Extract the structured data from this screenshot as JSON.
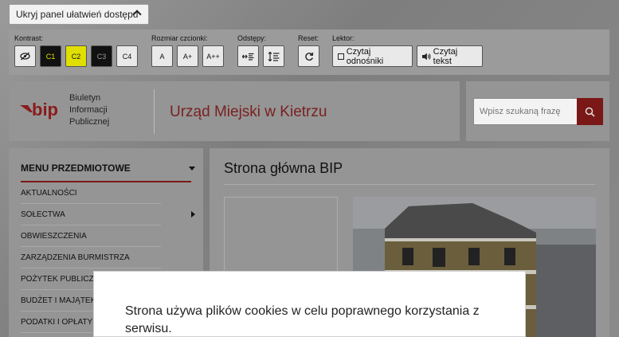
{
  "accessibility": {
    "toggle_label": "Ukryj panel ułatwień dostępu",
    "contrast_label": "Kontrast:",
    "contrast_buttons": [
      "C1",
      "C2",
      "C3",
      "C4"
    ],
    "font_label": "Rozmiar czcionki:",
    "font_buttons": [
      "A",
      "A+",
      "A++"
    ],
    "spacing_label": "Odstępy:",
    "reset_label": "Reset:",
    "reader_label": "Lektor:",
    "read_links_label": "Czytaj odnośniki",
    "read_text_label": "Czytaj tekst"
  },
  "header": {
    "logo_word": "bip",
    "logo_lines": [
      "Biuletyn",
      "Informacji",
      "Publicznej"
    ],
    "org_name": "Urząd Miejski w Kietrzu"
  },
  "search": {
    "placeholder": "Wpisz szukaną frazę"
  },
  "sidebar": {
    "title": "MENU PRZEDMIOTOWE",
    "items": [
      {
        "label": "AKTUALNOŚCI"
      },
      {
        "label": "SOŁECTWA"
      },
      {
        "label": "OBWIESZCZENIA"
      },
      {
        "label": "ZARZĄDZENIA BURMISTRZA"
      },
      {
        "label": "POŻYTEK PUBLICZNY"
      },
      {
        "label": "BUDŻET I MAJĄTEK"
      },
      {
        "label": "PODATKI I OPŁATY"
      }
    ]
  },
  "main": {
    "title": "Strona główna BIP"
  },
  "cookie": {
    "text": "Strona używa plików cookies w celu poprawnego korzystania z serwisu."
  },
  "colors": {
    "accent": "#a42727",
    "panel_bg": "#9b9b9b",
    "highlight_yellow": "#e0e000"
  }
}
